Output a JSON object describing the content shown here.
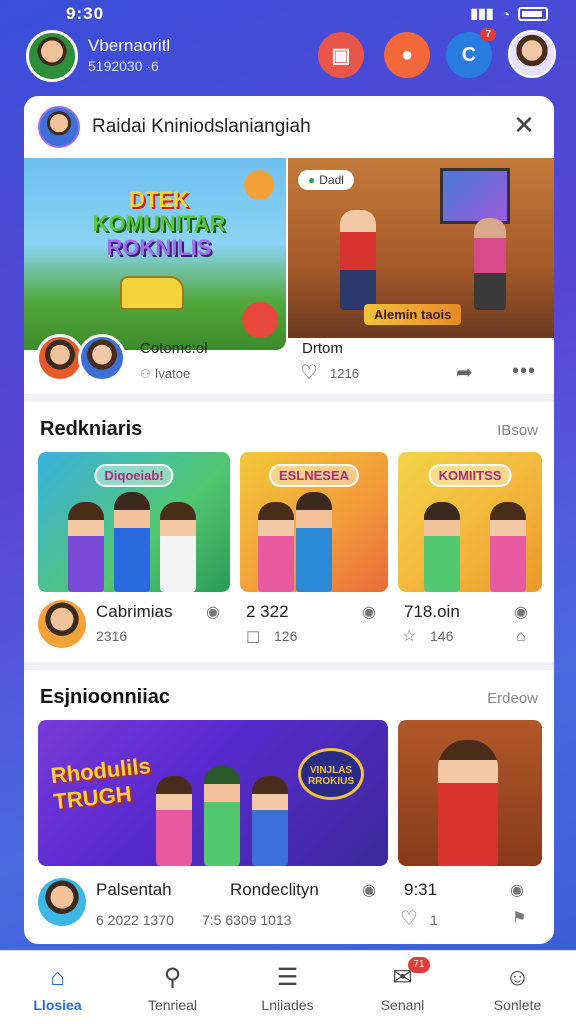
{
  "status": {
    "time": "9:30",
    "signal": "▮▮▮",
    "wifi": "◔"
  },
  "profile": {
    "name": "Vbernaoritl",
    "subtitle": "5192030 ·6"
  },
  "header_buttons": [
    {
      "icon": "chat-icon",
      "glyph": "▣"
    },
    {
      "icon": "fire-icon",
      "glyph": "●"
    },
    {
      "icon": "notification-icon",
      "glyph": "C",
      "badge": "7"
    }
  ],
  "card": {
    "title": "Raidai Kniniodslaniangiah",
    "close_glyph": "✕",
    "hero": {
      "left_title_1": "DTEK",
      "left_title_2": "KOMUNITAR",
      "left_title_3": "ROKNILIS",
      "pill": "Dadl",
      "caption": "Alemin taois"
    },
    "meta": {
      "left_title": "Cotomc:ol",
      "left_stat": "Ivatoe",
      "right_title": "Drtom",
      "right_stat": "1216"
    }
  },
  "section1": {
    "title": "Redkniaris",
    "link": "IBsow",
    "thumbs": [
      "Diqoeiab!",
      "ESLNESEA",
      "KOMIITSS"
    ],
    "items": [
      {
        "title": "Cabrimias",
        "stat": "2316"
      },
      {
        "title": "2 322",
        "stat": "126"
      },
      {
        "title": "718.oin",
        "stat": "146"
      }
    ]
  },
  "section2": {
    "title": "Esjnioonniiac",
    "link": "Erdeow",
    "big_label": "Rhodulils",
    "big_label_2": "TRUGH",
    "bubble_text": "VINJLAS RROKIUS",
    "items": [
      {
        "title": "Palsentah",
        "stat": "6 2022 1370"
      },
      {
        "title": "Rondeclityn",
        "stat": "7:5 6309 1013"
      },
      {
        "title": "9:31",
        "stat": "1"
      }
    ]
  },
  "nav": [
    {
      "label": "Llosiea",
      "glyph": "⌂",
      "active": true
    },
    {
      "label": "Tenrieal",
      "glyph": "⚲",
      "active": false
    },
    {
      "label": "Lniiades",
      "glyph": "☰",
      "active": false
    },
    {
      "label": "Senanl",
      "glyph": "✉",
      "badge": "71",
      "active": false
    },
    {
      "label": "Sonlete",
      "glyph": "☺",
      "active": false
    }
  ],
  "colors": {
    "accent": "#2a6ae0",
    "background": "#4a55d8",
    "badge": "#e23b3b"
  }
}
